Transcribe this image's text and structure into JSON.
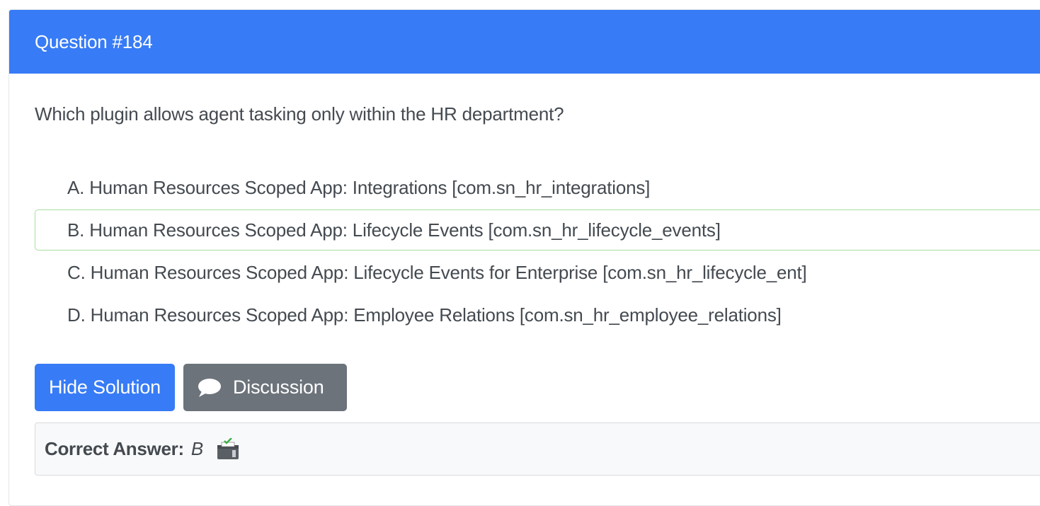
{
  "question": {
    "header": "Question #184",
    "text": "Which plugin allows agent tasking only within the HR department?"
  },
  "choices": [
    {
      "label": "A. Human Resources Scoped App: Integrations [com.sn_hr_integrations]"
    },
    {
      "label": "B. Human Resources Scoped App: Lifecycle Events [com.sn_hr_lifecycle_events]"
    },
    {
      "label": "C. Human Resources Scoped App: Lifecycle Events for Enterprise [com.sn_hr_lifecycle_ent]"
    },
    {
      "label": "D. Human Resources Scoped App: Employee Relations [com.sn_hr_employee_relations]"
    }
  ],
  "actions": {
    "hide_solution_label": "Hide Solution",
    "discussion_label": "Discussion",
    "discussion_icon": "speech-bubble-icon"
  },
  "answer": {
    "label": "Correct Answer:",
    "value": "B",
    "icon": "vote-box-icon"
  },
  "colors": {
    "primary": "#377bf6",
    "secondary": "#6c737b",
    "correct_border": "#a8df9f",
    "text": "#444a50"
  }
}
